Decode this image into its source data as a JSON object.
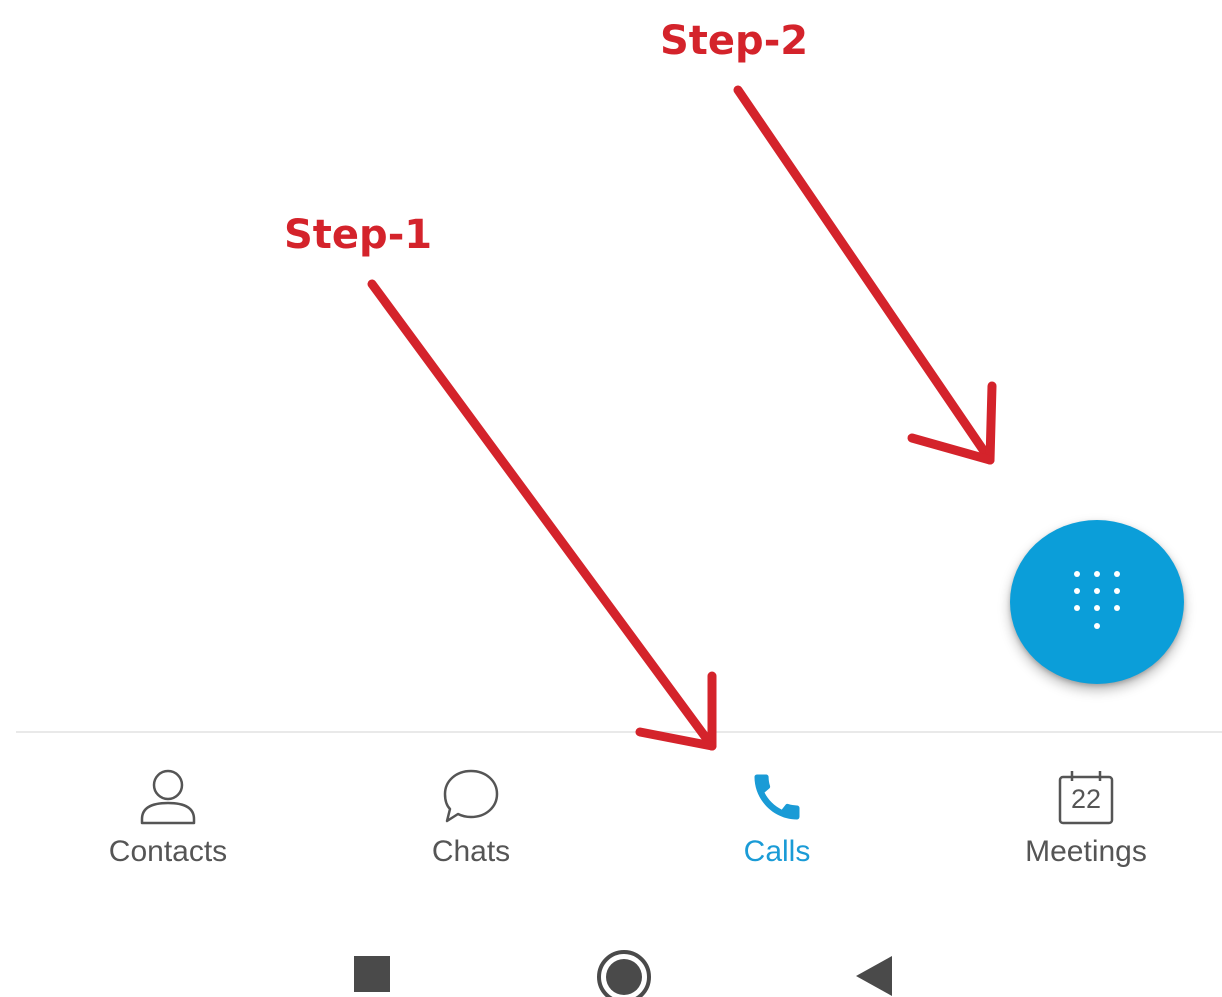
{
  "annotations": {
    "step1_label": "Step-1",
    "step2_label": "Step-2",
    "color": "#d4232b"
  },
  "fab": {
    "icon": "dialpad-icon",
    "color": "#0b9ed9"
  },
  "tabs": [
    {
      "label": "Contacts",
      "icon": "person-icon",
      "active": false
    },
    {
      "label": "Chats",
      "icon": "chat-bubble-icon",
      "active": false
    },
    {
      "label": "Calls",
      "icon": "phone-icon",
      "active": true
    },
    {
      "label": "Meetings",
      "icon": "calendar-icon",
      "active": false,
      "calendar_day": "22"
    }
  ],
  "colors": {
    "active_tab": "#1a9bd6",
    "inactive_tab": "#555555"
  },
  "navbar": {
    "buttons": [
      "recents-icon",
      "home-icon",
      "back-icon"
    ]
  }
}
